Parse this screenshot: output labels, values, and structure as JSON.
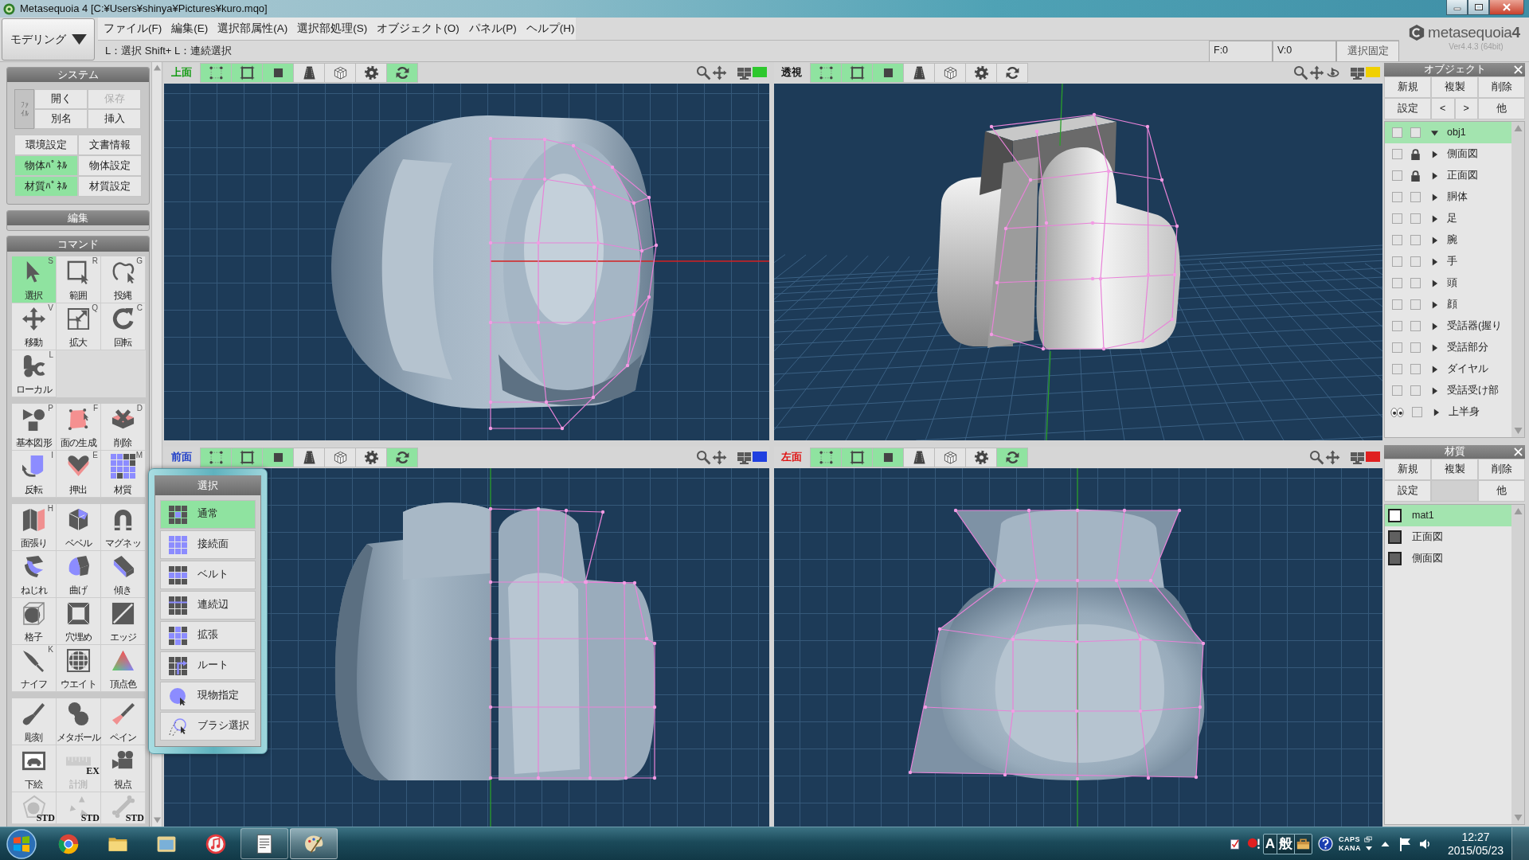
{
  "window": {
    "title": "Metasequoia 4 [C:¥Users¥shinya¥Pictures¥kuro.mqo]"
  },
  "mode_dropdown": {
    "value": "モデリング"
  },
  "menu": [
    "ファイル(F)",
    "編集(E)",
    "選択部属性(A)",
    "選択部処理(S)",
    "オブジェクト(O)",
    "パネル(P)",
    "ヘルプ(H)"
  ],
  "hint": "L：選択 Shift+ L：連続選択",
  "counters": [
    "F:0",
    "V:0"
  ],
  "lock_button": {
    "label": "選択固定"
  },
  "logo": {
    "text": "metasequoia**4**",
    "version": "Ver4.4.3 (64bit)"
  },
  "system_panel": {
    "title": "システム",
    "file_label": "ﾌｧｲﾙ",
    "file_buttons": [
      {
        "label": "開く",
        "disabled": false
      },
      {
        "label": "保存",
        "disabled": true
      },
      {
        "label": "別名",
        "disabled": false
      },
      {
        "label": "挿入",
        "disabled": false
      }
    ],
    "toggles": [
      {
        "label": "環境設定",
        "on": false
      },
      {
        "label": "文書情報",
        "on": false
      },
      {
        "label": "物体ﾊﾟﾈﾙ",
        "on": true
      },
      {
        "label": "物体設定",
        "on": false
      },
      {
        "label": "材質ﾊﾟﾈﾙ",
        "on": true
      },
      {
        "label": "材質設定",
        "on": false
      }
    ]
  },
  "edit_panel": {
    "title": "編集"
  },
  "command_panel": {
    "title": "コマンド",
    "groups": [
      [
        {
          "kind": "select",
          "label": "選択",
          "key": "S",
          "selected": true,
          "disabled": false
        },
        {
          "kind": "range",
          "label": "範囲",
          "key": "R",
          "selected": false,
          "disabled": false
        },
        {
          "kind": "lasso",
          "label": "投縄",
          "key": "G",
          "selected": false,
          "disabled": false
        },
        {
          "kind": "move",
          "label": "移動",
          "key": "V",
          "selected": false,
          "disabled": false
        },
        {
          "kind": "scale",
          "label": "拡大",
          "key": "Q",
          "selected": false,
          "disabled": false
        },
        {
          "kind": "rotate",
          "label": "回転",
          "key": "C",
          "selected": false,
          "disabled": false
        },
        {
          "kind": "local",
          "label": "ローカル",
          "key": "L",
          "selected": false,
          "disabled": false
        }
      ],
      [
        {
          "kind": "primitive",
          "label": "基本図形",
          "key": "P",
          "selected": false,
          "disabled": false
        },
        {
          "kind": "face",
          "label": "面の生成",
          "key": "F",
          "selected": false,
          "disabled": false
        },
        {
          "kind": "delete",
          "label": "削除",
          "key": "D",
          "selected": false,
          "disabled": false
        },
        {
          "kind": "flip",
          "label": "反転",
          "key": "I",
          "selected": false,
          "disabled": false
        },
        {
          "kind": "extrude",
          "label": "押出",
          "key": "E",
          "selected": false,
          "disabled": false
        },
        {
          "kind": "material",
          "label": "材質",
          "key": "M",
          "selected": false,
          "disabled": false
        }
      ],
      [
        {
          "kind": "stitch",
          "label": "面張り",
          "key": "H",
          "selected": false,
          "disabled": false
        },
        {
          "kind": "bevel",
          "label": "ベベル",
          "selected": false,
          "disabled": false
        },
        {
          "kind": "magnet",
          "label": "マグネッ",
          "selected": false,
          "disabled": false
        },
        {
          "kind": "twist",
          "label": "ねじれ",
          "selected": false,
          "disabled": false
        },
        {
          "kind": "bend",
          "label": "曲げ",
          "selected": false,
          "disabled": false
        },
        {
          "kind": "lean",
          "label": "傾き",
          "selected": false,
          "disabled": false
        },
        {
          "kind": "lattice",
          "label": "格子",
          "selected": false,
          "disabled": false
        },
        {
          "kind": "fill",
          "label": "穴埋め",
          "selected": false,
          "disabled": false
        },
        {
          "kind": "edge",
          "label": "エッジ",
          "selected": false,
          "disabled": false
        },
        {
          "kind": "knife",
          "label": "ナイフ",
          "key": "K",
          "selected": false,
          "disabled": false
        },
        {
          "kind": "weight",
          "label": "ウエイト",
          "selected": false,
          "disabled": false
        },
        {
          "kind": "vcolor",
          "label": "頂点色",
          "selected": false,
          "disabled": false
        }
      ],
      [
        {
          "kind": "sculpt",
          "label": "彫刻",
          "selected": false,
          "disabled": false
        },
        {
          "kind": "metaball",
          "label": "メタボール",
          "selected": false,
          "disabled": false
        },
        {
          "kind": "paint",
          "label": "ペイン",
          "selected": false,
          "disabled": false
        },
        {
          "kind": "underlay",
          "label": "下絵",
          "selected": false,
          "disabled": false
        },
        {
          "kind": "measure",
          "label": "計測",
          "badge": "EX",
          "selected": false,
          "disabled": true
        },
        {
          "kind": "camera",
          "label": "視点",
          "selected": false,
          "disabled": false
        },
        {
          "kind": "std-shape",
          "badge": "STD",
          "selected": false,
          "disabled": true
        },
        {
          "kind": "std-points",
          "badge": "STD",
          "selected": false,
          "disabled": true
        },
        {
          "kind": "std-bone",
          "badge": "STD",
          "selected": false,
          "disabled": true
        }
      ]
    ]
  },
  "select_popup": {
    "title": "選択",
    "items": [
      {
        "kind": "normal",
        "label": "通常",
        "selected": true
      },
      {
        "kind": "connected",
        "label": "接続面",
        "selected": false
      },
      {
        "kind": "belt",
        "label": "ベルト",
        "selected": false
      },
      {
        "kind": "loop",
        "label": "連続辺",
        "selected": false
      },
      {
        "kind": "expand",
        "label": "拡張",
        "selected": false
      },
      {
        "kind": "route",
        "label": "ルート",
        "selected": false
      },
      {
        "kind": "point",
        "label": "現物指定",
        "selected": false
      },
      {
        "kind": "brush",
        "label": "ブラシ選択",
        "selected": false
      }
    ]
  },
  "viewports": [
    {
      "label": "上面",
      "color": "#119a11",
      "screen": {
        "color": "#2ec82e"
      },
      "kind": "top",
      "tools": [
        {
          "kind": "vertex",
          "on": true
        },
        {
          "kind": "edge",
          "on": true
        },
        {
          "kind": "face",
          "on": true
        },
        {
          "kind": "shading",
          "on": false
        },
        {
          "kind": "cube",
          "on": false
        },
        {
          "kind": "settings",
          "on": false
        },
        {
          "kind": "sync",
          "on": true
        }
      ],
      "nav": [
        {
          "kind": "zoom"
        },
        {
          "kind": "pan"
        }
      ]
    },
    {
      "label": "透視",
      "color": "#111111",
      "screen": {
        "color": "#f0d000"
      },
      "kind": "perspective",
      "tools": [
        {
          "kind": "vertex",
          "on": true
        },
        {
          "kind": "edge",
          "on": true
        },
        {
          "kind": "face",
          "on": true
        },
        {
          "kind": "shading",
          "on": false
        },
        {
          "kind": "cube",
          "on": false
        },
        {
          "kind": "settings",
          "on": false
        },
        {
          "kind": "sync",
          "on": false
        }
      ],
      "nav": [
        {
          "kind": "zoom"
        },
        {
          "kind": "pan"
        },
        {
          "kind": "orbit"
        }
      ]
    },
    {
      "label": "前面",
      "color": "#1c3cc8",
      "screen": {
        "color": "#2040e0"
      },
      "kind": "front",
      "tools": [
        {
          "kind": "vertex",
          "on": true
        },
        {
          "kind": "edge",
          "on": true
        },
        {
          "kind": "face",
          "on": true
        },
        {
          "kind": "shading",
          "on": false
        },
        {
          "kind": "cube",
          "on": false
        },
        {
          "kind": "settings",
          "on": false
        },
        {
          "kind": "sync",
          "on": true
        }
      ],
      "nav": [
        {
          "kind": "zoom"
        },
        {
          "kind": "pan"
        }
      ]
    },
    {
      "label": "左面",
      "color": "#e01010",
      "screen": {
        "color": "#e02020"
      },
      "kind": "left",
      "tools": [
        {
          "kind": "vertex",
          "on": true
        },
        {
          "kind": "edge",
          "on": true
        },
        {
          "kind": "face",
          "on": true
        },
        {
          "kind": "shading",
          "on": false
        },
        {
          "kind": "cube",
          "on": false
        },
        {
          "kind": "settings",
          "on": false
        },
        {
          "kind": "sync",
          "on": true
        }
      ],
      "nav": [
        {
          "kind": "zoom"
        },
        {
          "kind": "pan"
        }
      ]
    }
  ],
  "object_panel": {
    "title": "オブジェクト",
    "buttons": [
      [
        "新規",
        "複製",
        "削除"
      ],
      [
        "設定",
        "<",
        ">",
        "他"
      ]
    ],
    "items": [
      {
        "name": "obj1",
        "visible": false,
        "locked": false,
        "expanded": true,
        "selected": true
      },
      {
        "name": "側面図",
        "visible": false,
        "locked": true,
        "expanded": false,
        "selected": false
      },
      {
        "name": "正面図",
        "visible": false,
        "locked": true,
        "expanded": false,
        "selected": false
      },
      {
        "name": "胴体",
        "visible": false,
        "locked": false,
        "expanded": false,
        "selected": false
      },
      {
        "name": "足",
        "visible": false,
        "locked": false,
        "expanded": false,
        "selected": false
      },
      {
        "name": "腕",
        "visible": false,
        "locked": false,
        "expanded": false,
        "selected": false
      },
      {
        "name": "手",
        "visible": false,
        "locked": false,
        "expanded": false,
        "selected": false
      },
      {
        "name": "頭",
        "visible": false,
        "locked": false,
        "expanded": false,
        "selected": false
      },
      {
        "name": "顔",
        "visible": false,
        "locked": false,
        "expanded": false,
        "selected": false
      },
      {
        "name": "受話器(握り",
        "visible": false,
        "locked": false,
        "expanded": false,
        "selected": false
      },
      {
        "name": "受話部分",
        "visible": false,
        "locked": false,
        "expanded": false,
        "selected": false
      },
      {
        "name": "ダイヤル",
        "visible": false,
        "locked": false,
        "expanded": false,
        "selected": false
      },
      {
        "name": "受話受け部",
        "visible": false,
        "locked": false,
        "expanded": false,
        "selected": false
      },
      {
        "name": "上半身",
        "visible": true,
        "locked": false,
        "expanded": false,
        "selected": false
      }
    ]
  },
  "material_panel": {
    "title": "材質",
    "buttons": [
      [
        "新規",
        "複製",
        "削除"
      ],
      [
        "設定",
        "他"
      ]
    ],
    "items": [
      {
        "name": "mat1",
        "color": "#ffffff",
        "selected": true
      },
      {
        "name": "正面図",
        "color": "#606060",
        "selected": false
      },
      {
        "name": "側面図",
        "color": "#606060",
        "selected": false
      }
    ]
  },
  "taskbar": {
    "apps": [
      {
        "kind": "browser",
        "running": false,
        "selected": false
      },
      {
        "kind": "folder",
        "running": false,
        "selected": false
      },
      {
        "kind": "window",
        "running": false,
        "selected": false
      },
      {
        "kind": "music",
        "running": false,
        "selected": false
      },
      {
        "kind": "document",
        "running": true,
        "selected": false
      },
      {
        "kind": "palette",
        "running": true,
        "selected": true
      }
    ],
    "ime": [
      "A",
      "般"
    ],
    "keys": [
      "CAPS",
      "KANA"
    ],
    "time": "12:27",
    "date": "2015/05/23"
  }
}
